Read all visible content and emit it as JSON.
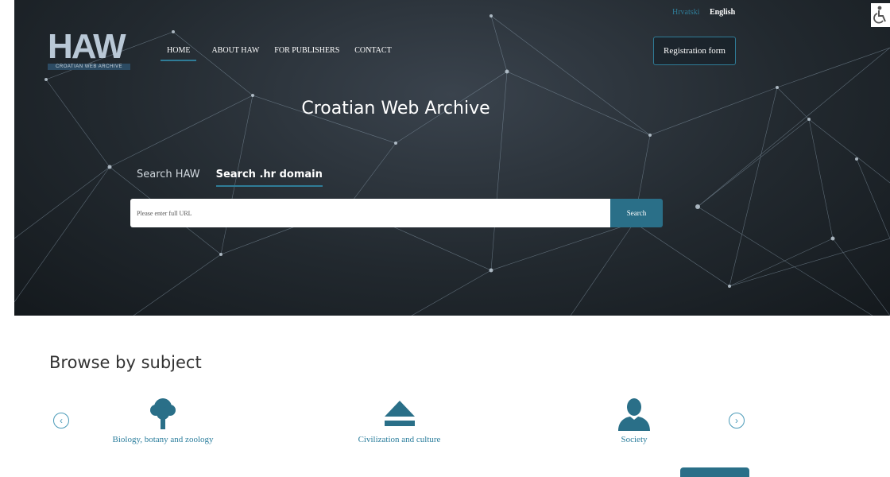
{
  "header": {
    "logo_text": "HAW",
    "logo_subtitle": "CROATIAN WEB ARCHIVE",
    "nav": [
      "HOME",
      "ABOUT HAW",
      "FOR PUBLISHERS",
      "CONTACT"
    ],
    "languages": {
      "croatian": "Hrvatski",
      "english": "English"
    },
    "registration_label": "Registration form"
  },
  "hero": {
    "title": "Croatian Web Archive",
    "tabs": [
      "Search HAW",
      "Search .hr domain"
    ],
    "active_tab": "Search .hr domain",
    "search_placeholder": "Please enter full URL",
    "search_button": "Search"
  },
  "browse": {
    "title": "Browse by subject",
    "subjects": [
      {
        "label": "Biology, botany and zoology",
        "icon": "tree-icon"
      },
      {
        "label": "Civilization and culture",
        "icon": "eject-icon"
      },
      {
        "label": "Society",
        "icon": "person-icon"
      }
    ],
    "prev_arrow": "‹",
    "next_arrow": "›"
  },
  "colors": {
    "accent": "#2a6f88",
    "link": "#2a7d9c"
  }
}
